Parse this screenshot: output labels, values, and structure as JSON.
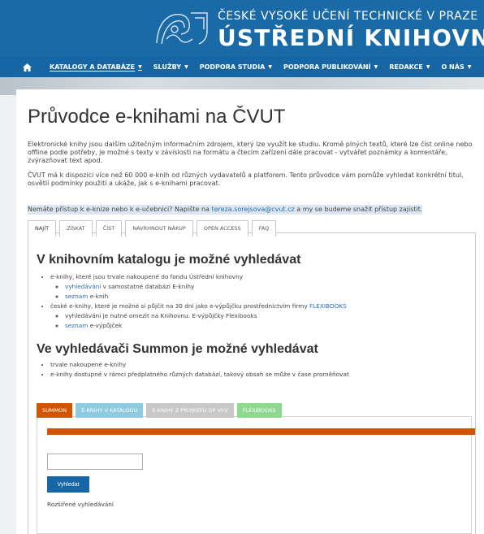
{
  "header": {
    "university": "ČESKÉ VYSOKÉ UČENÍ TECHNICKÉ V PRAZE",
    "library": "ÚSTŘEDNÍ KNIHOVNA"
  },
  "nav": {
    "home_icon": "home-icon",
    "items": [
      {
        "label": "KATALOGY A DATABÁZE"
      },
      {
        "label": "SLUŽBY"
      },
      {
        "label": "PODPORA STUDIA"
      },
      {
        "label": "PODPORA PUBLIKOVÁNÍ"
      },
      {
        "label": "REDAKCE"
      },
      {
        "label": "O NÁS"
      }
    ]
  },
  "page": {
    "title": "Průvodce e-knihami na ČVUT",
    "para1": "Elektronické knihy jsou dalším užitečným informačním zdrojem, který lze využít ke studiu. Kromě plných textů, které lze číst online nebo offline podle potřeby, je možné s texty v závislosti na formátu a čtecím zařízení dále pracovat - vytvářet poznámky a komentáře, zvýrazňovat text apod.",
    "para2": "ČVUT má k dispozici více než 60 000 e-knih od různých vydavatelů a platforem. Tento průvodce vám pomůže vyhledat konkrétní titul, osvětlí podmínky použití a ukáže, jak s e-knihami pracovat.",
    "para3_prefix": "Nemáte přístup k e-knize nebo k e-učebnici? Napište na ",
    "para3_email": "tereza.sorejsova@cvut.cz",
    "para3_suffix": " a my se budeme snažit přístup zajistit."
  },
  "tabs": [
    "NAJÍT",
    "ZÍSKAT",
    "ČÍST",
    "NAVRHNOUT NÁKUP",
    "OPEN ACCESS",
    "FAQ"
  ],
  "section1": {
    "heading": "V knihovním katalogu je možné vyhledávat",
    "item1": "e-knihy, které jsou trvale nakoupené do fondu Ústřední knihovny",
    "item1_sub1_link": "vyhledávání",
    "item1_sub1_rest": " v samostatné databázi E-knihy",
    "item1_sub2_link": "seznam",
    "item1_sub2_rest": " e-knih",
    "item2_prefix": "české e-knihy, které je možné si půjčit na 30 dní jako e-výpůjčku prostřednictvím firmy ",
    "item2_link": "FLEXIBOOKS",
    "item2_sub1": "vyhledávání je nutné omezit na Knihovnu: E-výpůjčky Flexibooks",
    "item2_sub2_link": "seznam",
    "item2_sub2_rest": " e-výpůjček"
  },
  "section2": {
    "heading": "Ve vyhledávači Summon je možné vyhledávat",
    "item1": "trvale nakoupené e-knihy",
    "item2": "e-knihy dostupné v rámci předplatného různých databází, takový obsah se může v čase proměňovat"
  },
  "search_tabs": [
    {
      "label": "SUMMON",
      "color": "#d35400"
    },
    {
      "label": "E-KNIHY V KATALOGU",
      "color": "#8ecbe0"
    },
    {
      "label": "E-KNIHY Z PROJEKTU OP VVV",
      "color": "#c8c8c8"
    },
    {
      "label": "FLEXIBOOKS",
      "color": "#8fd98f"
    }
  ],
  "search": {
    "button_label": "Vyhledat",
    "advanced_label": "Rozšířené vyhledávání"
  },
  "colors": {
    "brand_blue": "#1a6aa8",
    "link": "#2a6cb2",
    "summon_orange": "#d35400"
  }
}
